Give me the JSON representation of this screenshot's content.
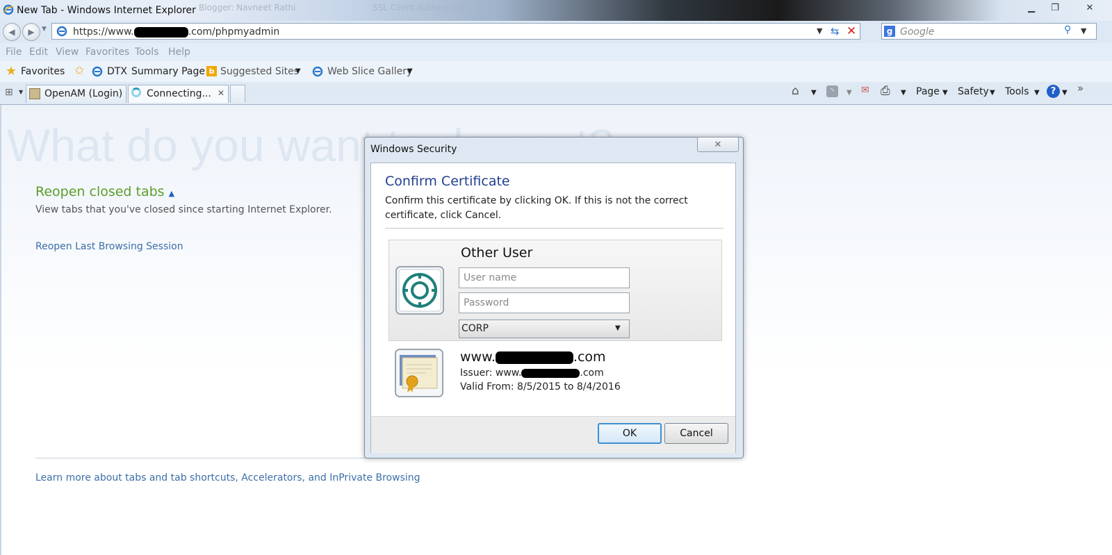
{
  "window": {
    "title": "New Tab - Windows Internet Explorer",
    "background_tabs": [
      "Blogger: Navneet Rathi",
      "SSL Client Authenticati"
    ]
  },
  "address_bar": {
    "url_prefix": "https://www.",
    "url_suffix": ".com/phpmyadmin",
    "search_placeholder": "Google"
  },
  "menu": [
    "File",
    "Edit",
    "View",
    "Favorites",
    "Tools",
    "Help"
  ],
  "favorites_bar": {
    "favorites_label": "Favorites",
    "items": [
      "DTX",
      "Summary Page",
      "Suggested Sites",
      "Web Slice Gallery"
    ]
  },
  "tabs": [
    {
      "label": "OpenAM (Login)",
      "active": false
    },
    {
      "label": "Connecting...",
      "active": true
    }
  ],
  "command_bar": {
    "page": "Page",
    "safety": "Safety",
    "tools": "Tools"
  },
  "new_tab_page": {
    "headline": "What do you want to do next?",
    "reopen_title": "Reopen closed tabs",
    "reopen_description": "View tabs that you've closed since starting Internet Explorer.",
    "reopen_session": "Reopen Last Browsing Session",
    "learn_more": "Learn more about tabs and tab shortcuts, Accelerators, and InPrivate Browsing"
  },
  "dialog": {
    "title": "Windows Security",
    "heading": "Confirm Certificate",
    "message": "Confirm this certificate by clicking OK. If this is not the correct certificate, click Cancel.",
    "credential": {
      "title": "Other User",
      "username_placeholder": "User name",
      "password_placeholder": "Password",
      "domain": "CORP"
    },
    "certificate": {
      "name_prefix": "www.",
      "name_suffix": ".com",
      "issuer_prefix": "Issuer: www.",
      "issuer_suffix": ".com",
      "valid": "Valid From: 8/5/2015 to 8/4/2016"
    },
    "ok_label": "OK",
    "cancel_label": "Cancel"
  },
  "colors": {
    "link": "#3c6ea8",
    "reopen_green": "#5b9e2a",
    "dialog_heading": "#1f3f8f",
    "ok_focus": "#3c8fd1"
  }
}
